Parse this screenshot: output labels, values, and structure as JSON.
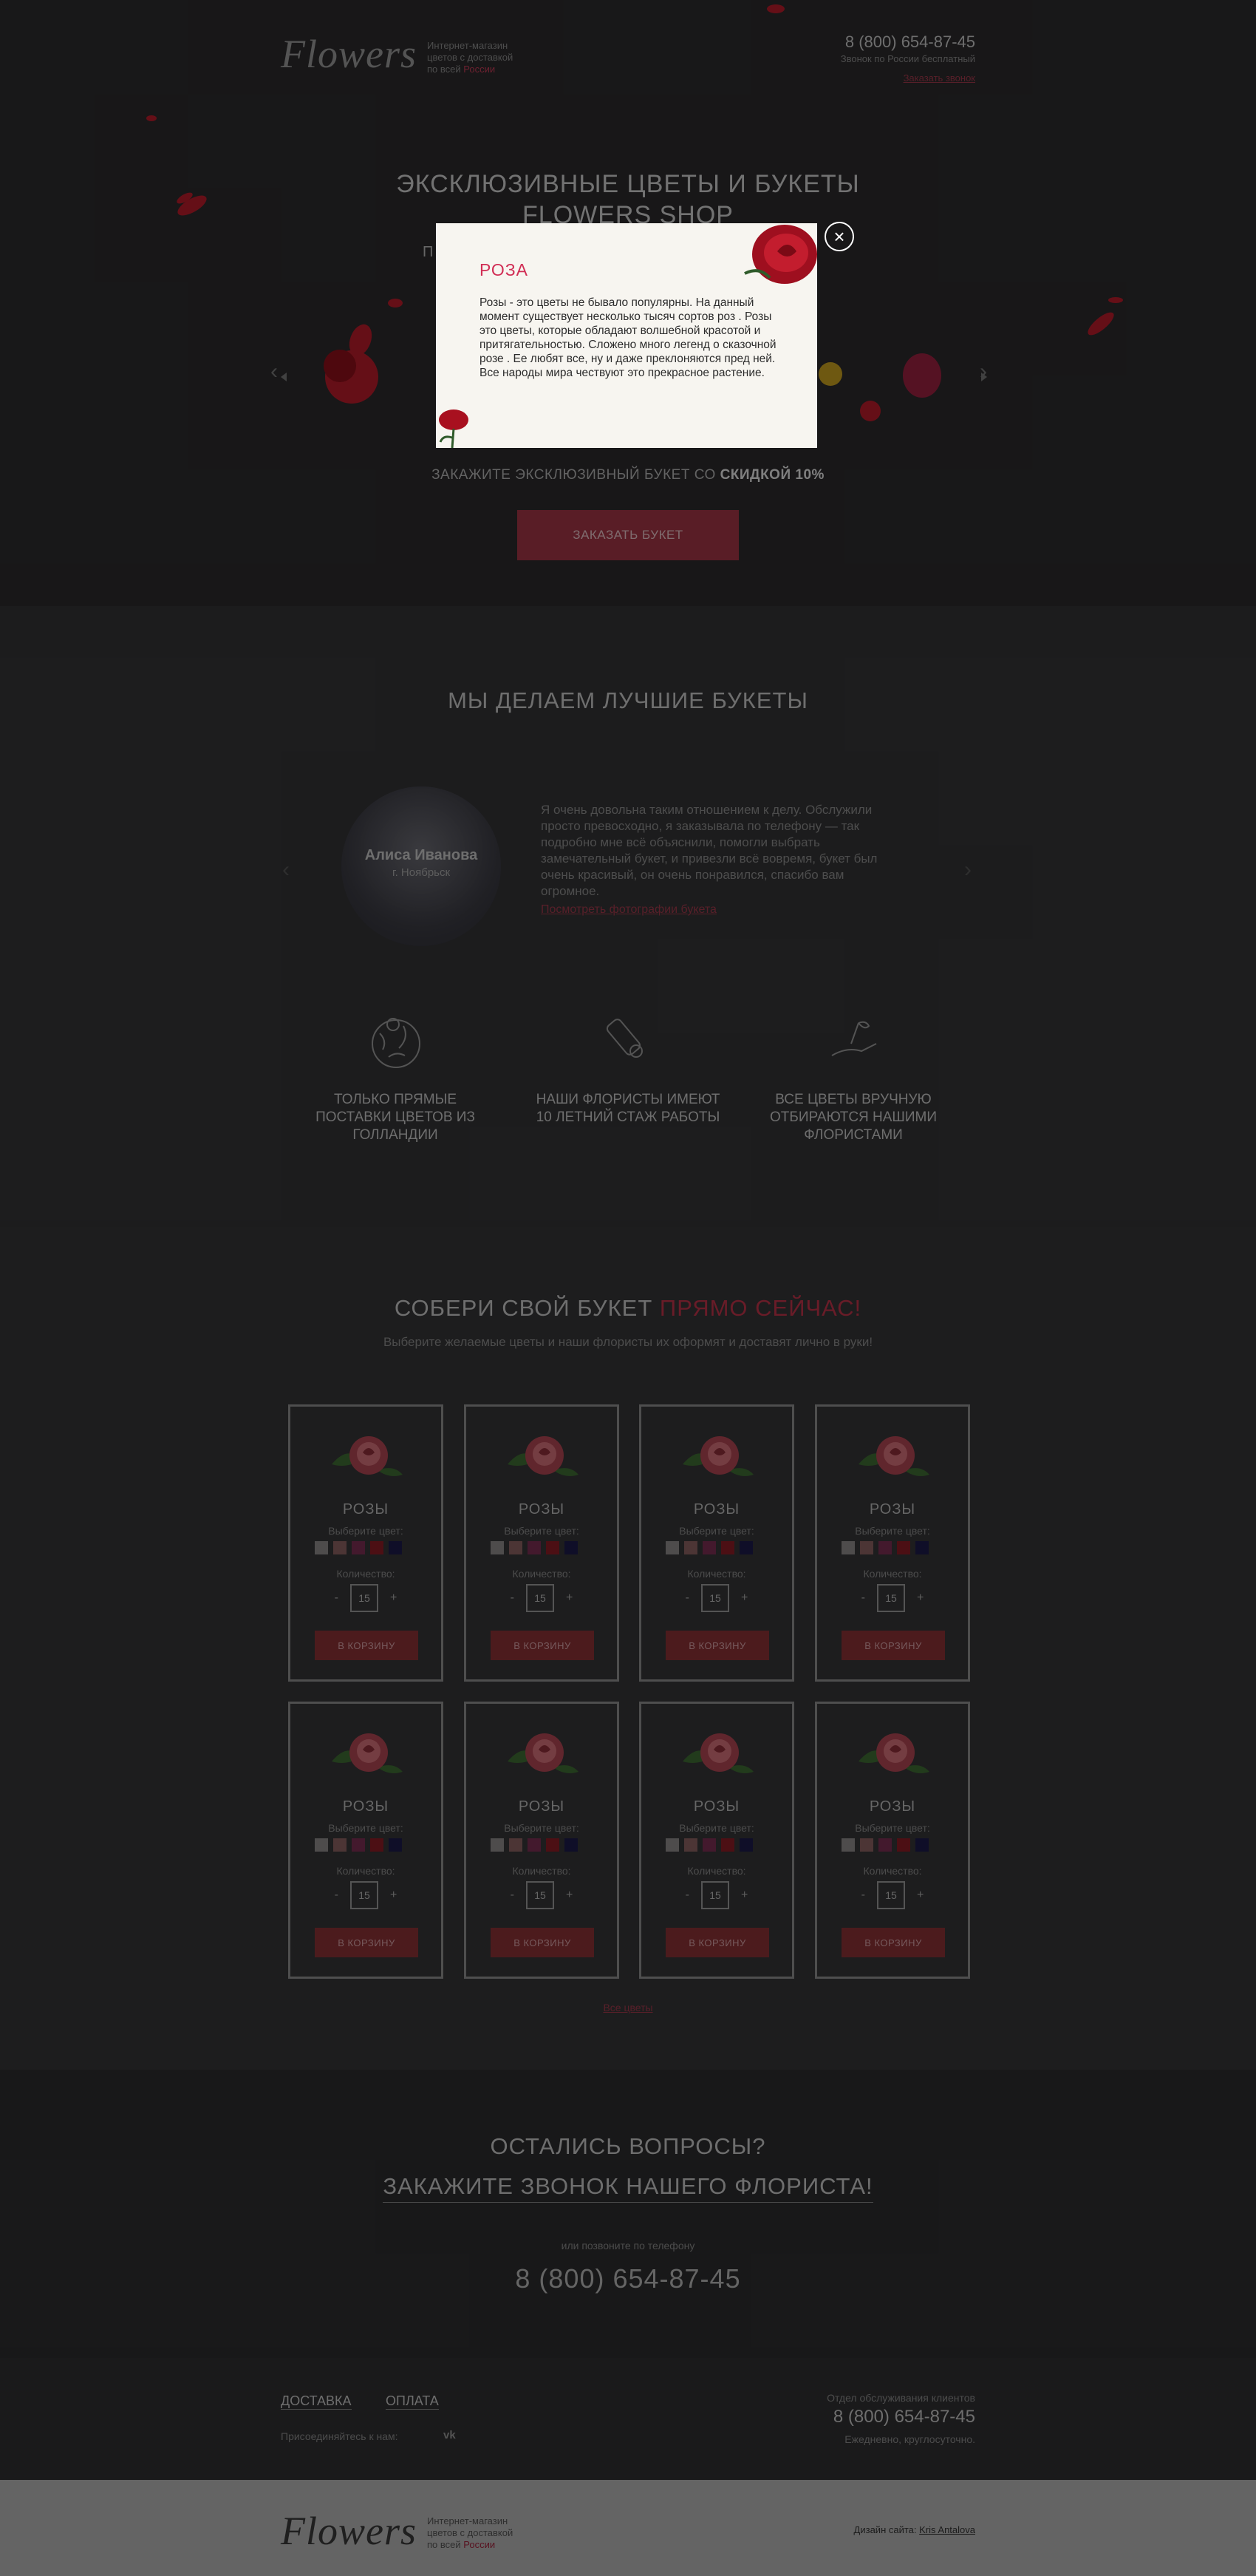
{
  "header": {
    "logo": "Flowers",
    "tagline_1": "Интернет-магазин",
    "tagline_2": "цветов с доставкой",
    "tagline_3": "по всей",
    "tagline_country": "России",
    "phone": "8 (800) 654-87-45",
    "phone_note": "Звонок по России бесплатный",
    "callback_link": "Заказать звонок"
  },
  "hero": {
    "title_1": "ЭКСКЛЮЗИВНЫЕ ЦВЕТЫ И БУКЕТЫ",
    "title_2": "FLOWERS SHOP",
    "subtitle_visible": "П",
    "discount_text": "ЗАКАЖИТЕ ЭКСКЛЮЗИВНЫЙ БУКЕТ СО",
    "discount_bold": "СКИДКОЙ 10%",
    "order_button": "ЗАКАЗАТЬ БУКЕТ",
    "arrow_left": "‹",
    "arrow_right": "›"
  },
  "modal": {
    "title": "РОЗА",
    "text": "Розы - это цветы не бывало популярны. На данный момент существует несколько тысяч сортов роз . Розы это цветы, которые обладают волшебной красотой и притягательностью. Сложено много легенд о сказочной розе . Ее любят все, ну и даже преклоняются пред ней. Все народы мира чествуют это прекрасное растение.",
    "close_label": "×"
  },
  "reviews": {
    "heading": "МЫ ДЕЛАЕМ ЛУЧШИЕ БУКЕТЫ",
    "name": "Алиса Иванова",
    "city": "г. Ноябрьск",
    "text": "Я очень довольна таким отношением к делу. Обслужили просто превосходно, я заказывала по телефону — так подробно мне всё объяснили, помогли выбрать замечательный букет, и привезли всё вовремя, букет был очень красивый, он очень понравился, спасибо вам огромное.",
    "photo_link": "Посмотреть фотографии букета",
    "arrow_left": "‹",
    "arrow_right": "›"
  },
  "features": [
    {
      "icon": "globe-pin-icon",
      "label": "ТОЛЬКО ПРЯМЫЕ ПОСТАВКИ ЦВЕТОВ ИЗ ГОЛЛАНДИИ"
    },
    {
      "icon": "diploma-icon",
      "label": "НАШИ ФЛОРИСТЫ ИМЕЮТ 10 ЛЕТНИЙ СТАЖ РАБОТЫ"
    },
    {
      "icon": "hand-flower-icon",
      "label": "ВСЕ ЦВЕТЫ ВРУЧНУЮ ОТБИРАЮТСЯ НАШИМИ ФЛОРИСТАМИ"
    }
  ],
  "builder": {
    "heading": "СОБЕРИ СВОЙ БУКЕТ",
    "heading_accent": "ПРЯМО СЕЙЧАС!",
    "subheading": "Выберите желаемые цветы и наши флористы их оформят и доставят лично в руки!",
    "all_flowers_link": "Все цветы",
    "swatch_colors": [
      "#8e8a8a",
      "#8b6262",
      "#7a2f52",
      "#8a1c26",
      "#1c1b4a"
    ],
    "products": [
      {
        "name": "РОЗЫ",
        "color_label": "Выберите цвет:",
        "qty_label": "Количество:",
        "qty": "15",
        "minus": "-",
        "plus": "+",
        "cart": "В КОРЗИНУ"
      },
      {
        "name": "РОЗЫ",
        "color_label": "Выберите цвет:",
        "qty_label": "Количество:",
        "qty": "15",
        "minus": "-",
        "plus": "+",
        "cart": "В КОРЗИНУ"
      },
      {
        "name": "РОЗЫ",
        "color_label": "Выберите цвет:",
        "qty_label": "Количество:",
        "qty": "15",
        "minus": "-",
        "plus": "+",
        "cart": "В КОРЗИНУ"
      },
      {
        "name": "РОЗЫ",
        "color_label": "Выберите цвет:",
        "qty_label": "Количество:",
        "qty": "15",
        "minus": "-",
        "plus": "+",
        "cart": "В КОРЗИНУ"
      },
      {
        "name": "РОЗЫ",
        "color_label": "Выберите цвет:",
        "qty_label": "Количество:",
        "qty": "15",
        "minus": "-",
        "plus": "+",
        "cart": "В КОРЗИНУ"
      },
      {
        "name": "РОЗЫ",
        "color_label": "Выберите цвет:",
        "qty_label": "Количество:",
        "qty": "15",
        "minus": "-",
        "plus": "+",
        "cart": "В КОРЗИНУ"
      },
      {
        "name": "РОЗЫ",
        "color_label": "Выберите цвет:",
        "qty_label": "Количество:",
        "qty": "15",
        "minus": "-",
        "plus": "+",
        "cart": "В КОРЗИНУ"
      },
      {
        "name": "РОЗЫ",
        "color_label": "Выберите цвет:",
        "qty_label": "Количество:",
        "qty": "15",
        "minus": "-",
        "plus": "+",
        "cart": "В КОРЗИНУ"
      }
    ]
  },
  "callback": {
    "heading": "ОСТАЛИСЬ ВОПРОСЫ?",
    "link": "ЗАКАЖИТЕ ЗВОНОК НАШЕГО ФЛОРИСТА!",
    "or_call": "или позвоните по телефону",
    "phone": "8 (800) 654-87-45"
  },
  "footer": {
    "delivery": "ДОСТАВКА",
    "payment": "ОПЛАТА",
    "join": "Присоединяйтесь к нам:",
    "vk": "vk",
    "service_label": "Отдел обслуживания клиентов",
    "phone": "8 (800) 654-87-45",
    "hours": "Ежедневно, круглосуточно."
  },
  "bottom": {
    "logo": "Flowers",
    "tagline_1": "Интернет-магазин",
    "tagline_2": "цветов с доставкой",
    "tagline_3": "по всей",
    "tagline_country": "России",
    "design_label": "Дизайн сайта:",
    "designer": "Kris Antalova"
  }
}
